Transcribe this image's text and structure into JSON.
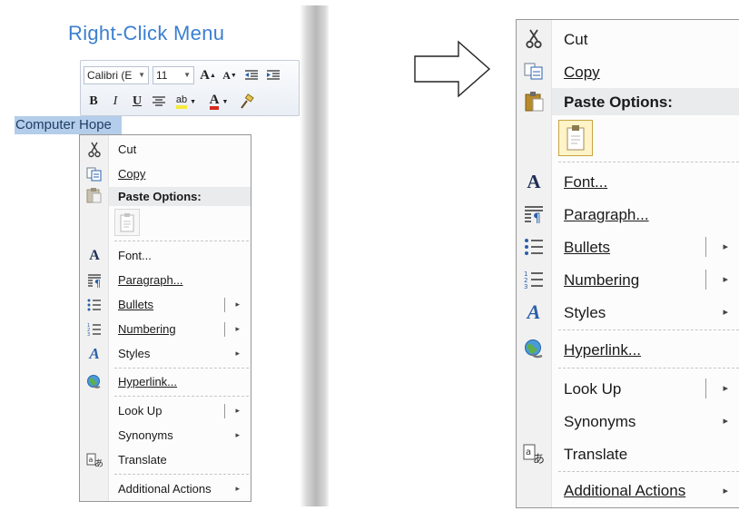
{
  "left": {
    "title": "Right-Click Menu",
    "selected_text": "Computer Hope",
    "toolbar": {
      "font_name": "Calibri (E",
      "font_size": "11",
      "row1_buttons": [
        "grow-font",
        "shrink-font",
        "decrease-indent",
        "increase-indent"
      ],
      "row2_buttons": [
        "bold",
        "italic",
        "underline",
        "center",
        "highlight",
        "font-color",
        "format-painter"
      ],
      "bold_label": "B",
      "italic_label": "I",
      "underline_label": "U",
      "grow_label": "A",
      "shrink_label": "A",
      "font_color_label": "A",
      "highlight_label": "ab"
    }
  },
  "menu": {
    "cut": "Cut",
    "copy": "Copy",
    "paste_options": "Paste Options:",
    "font": "Font...",
    "paragraph": "Paragraph...",
    "bullets": "Bullets",
    "numbering": "Numbering",
    "styles": "Styles",
    "hyperlink": "Hyperlink...",
    "look_up": "Look Up",
    "synonyms": "Synonyms",
    "translate": "Translate",
    "additional_actions": "Additional Actions",
    "submenu_arrow": "▸"
  },
  "colors": {
    "title": "#3b7fd0",
    "selection": "#b3cdea",
    "header_bg": "#e9ebed"
  }
}
